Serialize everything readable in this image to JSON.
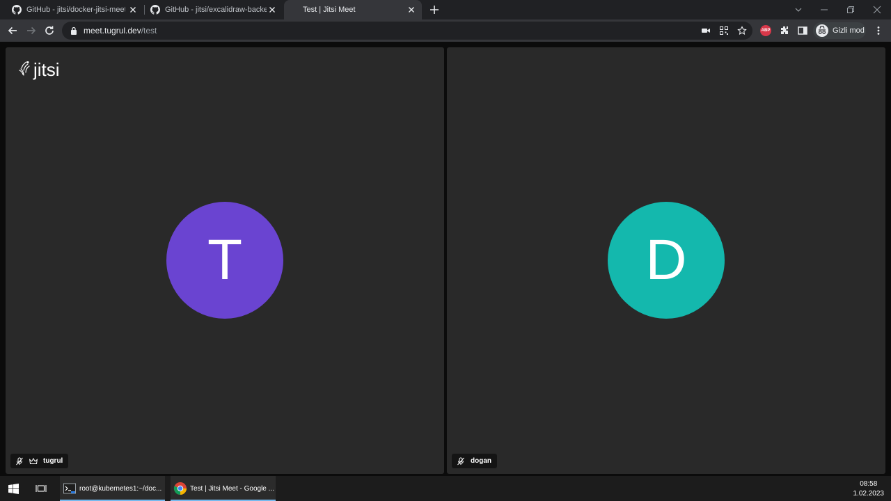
{
  "browser": {
    "tabs": [
      {
        "title": "GitHub - jitsi/docker-jitsi-meet: Jitsi",
        "icon": "github-icon",
        "active": false
      },
      {
        "title": "GitHub - jitsi/excalidraw-backend",
        "icon": "github-icon",
        "active": false
      },
      {
        "title": "Test | Jitsi Meet",
        "icon": "",
        "active": true
      }
    ],
    "url_host": "meet.tugrul.dev",
    "url_path": "/test",
    "abp_label": "ABP",
    "profile_label": "Gizli mod"
  },
  "meeting": {
    "logo_text": "jitsi",
    "participants": [
      {
        "initial": "T",
        "name": "tugrul",
        "avatar_color": "#6a44d1",
        "muted": true,
        "moderator": true
      },
      {
        "initial": "D",
        "name": "dogan",
        "avatar_color": "#14b8ad",
        "muted": true,
        "moderator": false
      }
    ]
  },
  "taskbar": {
    "tasks": [
      {
        "label": "root@kubernetes1:~/doc...",
        "icon": "terminal-icon"
      },
      {
        "label": "Test | Jitsi Meet - Google ...",
        "icon": "chrome-icon"
      }
    ],
    "time": "08:58",
    "date": "1.02.2023"
  }
}
